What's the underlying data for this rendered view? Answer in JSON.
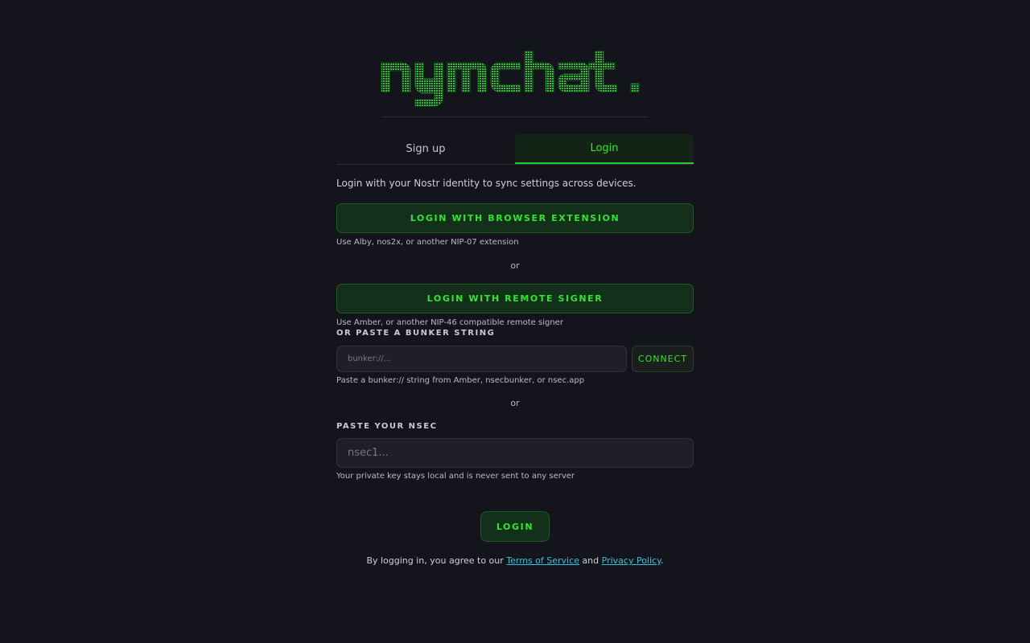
{
  "app": {
    "logo_text": "nymchat",
    "accent": "#2ee62e",
    "background": "#13141c"
  },
  "tabs": [
    {
      "label": "Sign up",
      "active": false
    },
    {
      "label": "Login",
      "active": true
    }
  ],
  "intro_text": "Login with your Nostr identity to sync settings across devices.",
  "extension": {
    "button_label": "LOGIN WITH BROWSER EXTENSION",
    "hint": "Use Alby, nos2x, or another NIP-07 extension"
  },
  "divider_or": "or",
  "remote_signer": {
    "button_label": "LOGIN WITH REMOTE SIGNER",
    "hint": "Use Amber, or another NIP-46 compatible remote signer"
  },
  "bunker": {
    "label": "OR PASTE A BUNKER STRING",
    "placeholder": "bunker://...",
    "value": "",
    "connect_label": "CONNECT",
    "hint": "Paste a bunker:// string from Amber, nsecbunker, or nsec.app"
  },
  "nsec": {
    "label": "PASTE YOUR NSEC",
    "placeholder": "nsec1...",
    "value": "",
    "hint": "Your private key stays local and is never sent to any server"
  },
  "login_button": "LOGIN",
  "legal": {
    "prefix": "By logging in, you agree to our ",
    "terms": "Terms of Service",
    "middle": " and ",
    "privacy": "Privacy Policy",
    "suffix": "."
  }
}
